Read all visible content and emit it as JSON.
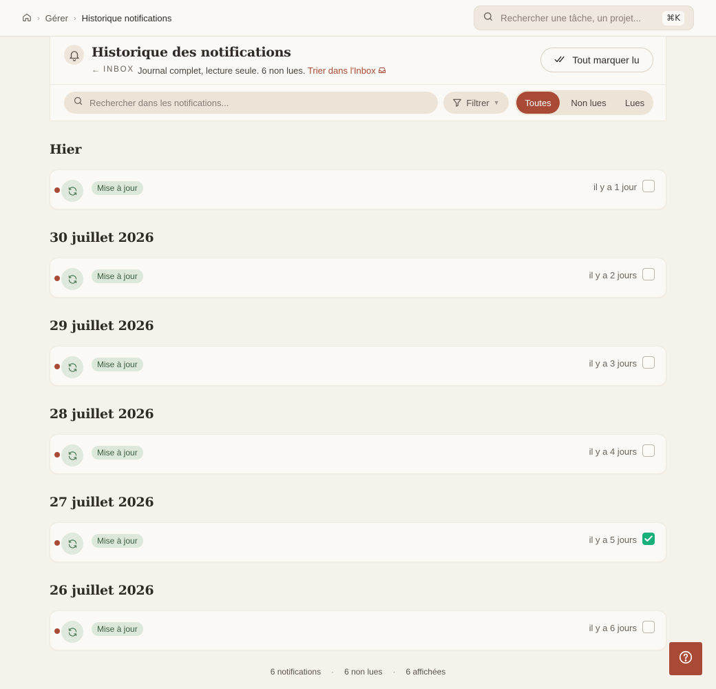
{
  "breadcrumb": {
    "home_icon": "home-icon",
    "items": [
      "Gérer",
      "Historique notifications"
    ]
  },
  "global_search": {
    "placeholder": "Rechercher une tâche, un projet...",
    "shortcut": "⌘K"
  },
  "header": {
    "title": "Historique des notifications",
    "back_label": "INBOX",
    "subtitle": "Journal complet, lecture seule. 6 non lues.",
    "sort_link": "Trier dans l'Inbox",
    "mark_all": "Tout marquer lu"
  },
  "toolbar": {
    "search_placeholder": "Rechercher dans les notifications...",
    "filter_label": "Filtrer",
    "segments": [
      "Toutes",
      "Non lues",
      "Lues"
    ],
    "active_segment": "Toutes"
  },
  "groups": [
    {
      "title": "Hier",
      "items": [
        {
          "badge": "Mise à jour",
          "time": "il y a 1 jour",
          "unread": true,
          "checked": false
        }
      ]
    },
    {
      "title": "30 juillet 2026",
      "items": [
        {
          "badge": "Mise à jour",
          "time": "il y a 2 jours",
          "unread": true,
          "checked": false
        }
      ]
    },
    {
      "title": "29 juillet 2026",
      "items": [
        {
          "badge": "Mise à jour",
          "time": "il y a 3 jours",
          "unread": true,
          "checked": false
        }
      ]
    },
    {
      "title": "28 juillet 2026",
      "items": [
        {
          "badge": "Mise à jour",
          "time": "il y a 4 jours",
          "unread": true,
          "checked": false
        }
      ]
    },
    {
      "title": "27 juillet 2026",
      "items": [
        {
          "badge": "Mise à jour",
          "time": "il y a 5 jours",
          "unread": true,
          "checked": true
        }
      ]
    },
    {
      "title": "26 juillet 2026",
      "items": [
        {
          "badge": "Mise à jour",
          "time": "il y a 6 jours",
          "unread": true,
          "checked": false
        }
      ]
    }
  ],
  "footer": {
    "total": "6 notifications",
    "unread": "6 non lues",
    "shown": "6 affichées"
  },
  "help_button": {
    "icon": "help-icon"
  },
  "colors": {
    "accent": "#a84a35",
    "checked": "#17b079",
    "badge_bg": "#dce8d9",
    "background": "#f5f1eb"
  }
}
